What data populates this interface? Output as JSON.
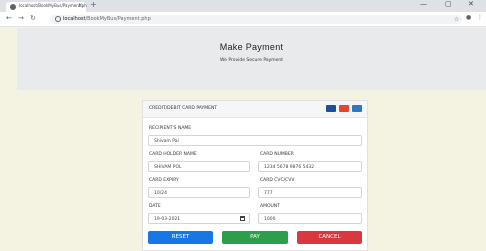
{
  "browser": {
    "tab_title": "localhost/BookMyBus/Payment.ph",
    "tab_close": "×",
    "new_tab": "+",
    "controls": {
      "minimize": "—",
      "maximize": "▢",
      "close": "✕"
    },
    "nav": {
      "back": "←",
      "forward": "→",
      "reload": "↻"
    },
    "address": {
      "host": "localhost",
      "path": "/BookMyBus/Payment.php"
    }
  },
  "hero": {
    "title": "Make Payment",
    "subtitle": "We Provide Secure Payment"
  },
  "card": {
    "header": "CREDIT/DEBIT CARD PAYMENT",
    "logos": [
      {
        "name": "visa",
        "color": "#1a4f9c"
      },
      {
        "name": "mastercard",
        "color": "#e8442b"
      },
      {
        "name": "amex",
        "color": "#2a78c8"
      }
    ]
  },
  "form": {
    "recipient_label": "RECIPIENT'S NAME",
    "recipient_value": "Shivam Pal",
    "holder_label": "CARD HOLDER NAME",
    "holder_value": "SHIVAM POL",
    "number_label": "CARD NUMBER",
    "number_value": "1234 5678 9876 5432",
    "expiry_label": "CARD EXPIRY",
    "expiry_value": "10/24",
    "cvc_label": "CARD CVC/CVV",
    "cvc_value": "777",
    "date_label": "DATE",
    "date_value": "19-03-2021",
    "amount_label": "AMOUNT",
    "amount_value": "1000"
  },
  "buttons": {
    "reset": {
      "label": "RESET",
      "color": "#1877e3"
    },
    "pay": {
      "label": "PAY",
      "color": "#2e9e4c"
    },
    "cancel": {
      "label": "CANCEL",
      "color": "#d9383f"
    }
  }
}
